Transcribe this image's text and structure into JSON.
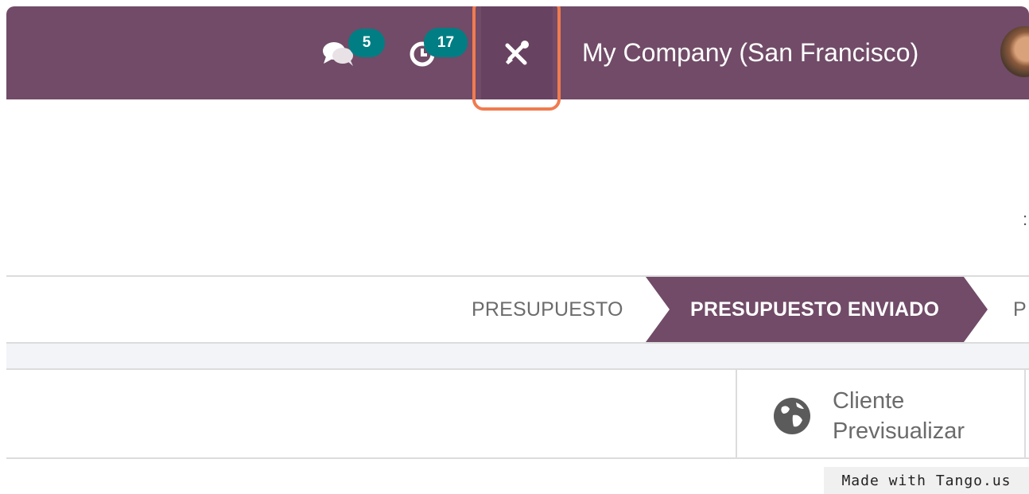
{
  "navbar": {
    "messages_count": "5",
    "activities_count": "17",
    "company_name": "My Company (San Francisco)",
    "colors": {
      "primary": "#714b67",
      "badge": "#017e84",
      "highlight": "#f07b4f"
    }
  },
  "content": {
    "partial_char": ":"
  },
  "statusbar": {
    "stages": [
      {
        "label": "PRESUPUESTO",
        "active": false
      },
      {
        "label": "PRESUPUESTO ENVIADO",
        "active": true
      },
      {
        "label": "P",
        "active": false
      }
    ]
  },
  "preview": {
    "line1": "Cliente",
    "line2": "Previsualizar",
    "icon": "globe-icon"
  },
  "watermark": "Made with Tango.us"
}
